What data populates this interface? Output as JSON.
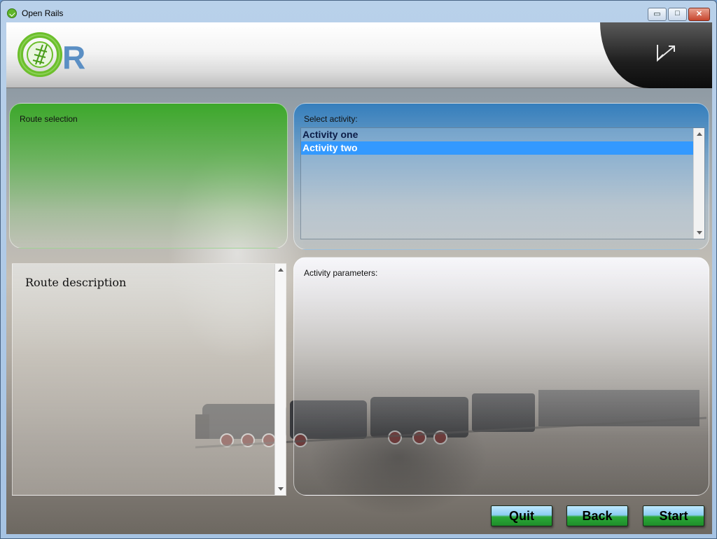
{
  "window": {
    "title": "Open Rails",
    "controls": {
      "minimize_glyph": "▭",
      "maximize_glyph": "□",
      "close_glyph": "✕"
    }
  },
  "header": {
    "logo_letter": "R",
    "accent_green": "#5fb52a",
    "accent_blue": "#5b8fc4"
  },
  "route_selection": {
    "label": "Route selection"
  },
  "select_activity": {
    "label": "Select activity:",
    "items": [
      {
        "label": "Activity one",
        "selected": false
      },
      {
        "label": "Activity two",
        "selected": true
      }
    ],
    "selection_color": "#3399ff"
  },
  "route_description": {
    "title": "Route description"
  },
  "activity_parameters": {
    "label": "Activity parameters:"
  },
  "buttons": {
    "quit": "Quit",
    "back": "Back",
    "start": "Start"
  }
}
